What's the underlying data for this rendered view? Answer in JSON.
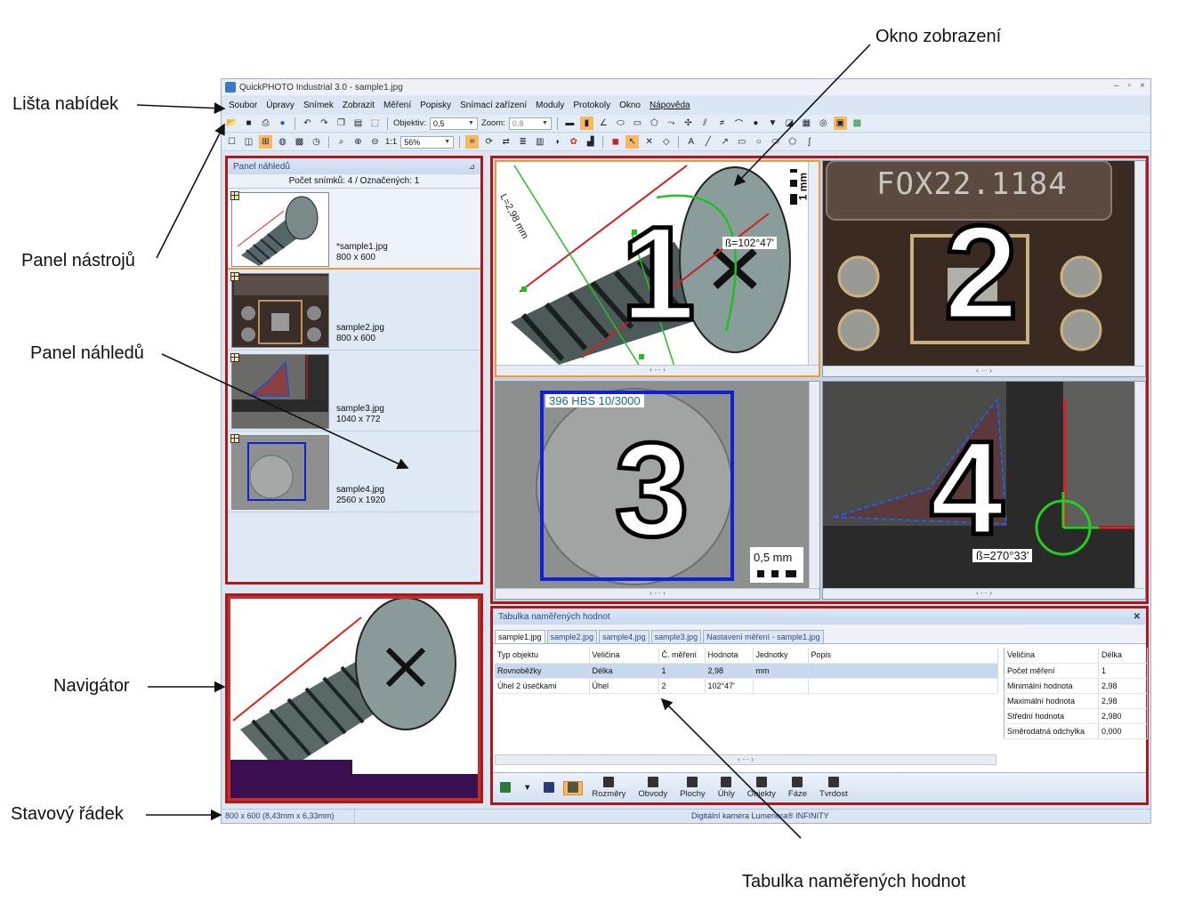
{
  "callouts": {
    "menu_bar": "Lišta nabídek",
    "toolbar": "Panel nástrojů",
    "thumbnail_panel": "Panel náhledů",
    "navigator": "Navigátor",
    "status_bar": "Stavový řádek",
    "display_window": "Okno zobrazení",
    "measurement_table": "Tabulka naměřených hodnot"
  },
  "window": {
    "title": "QuickPHOTO Industrial 3.0 - sample1.jpg",
    "controls": [
      "–",
      "▫",
      "×"
    ]
  },
  "menu": [
    "Soubor",
    "Úpravy",
    "Snímek",
    "Zobrazit",
    "Měření",
    "Popisky",
    "Snímací zařízení",
    "Moduly",
    "Protokoly",
    "Okno",
    "Nápověda"
  ],
  "toolbar": {
    "objective_label": "Objektiv:",
    "objective_value": "0,5",
    "zoom_label": "Zoom:",
    "zoom_value": "0,8",
    "scale_label": "1:1",
    "scale_value": "56%"
  },
  "thumbnail_panel": {
    "title": "Panel náhledů",
    "count_text": "Počet snímků: 4 / Označených: 1",
    "items": [
      {
        "name": "*sample1.jpg",
        "size": "800 x 600"
      },
      {
        "name": "sample2.jpg",
        "size": "800 x 600"
      },
      {
        "name": "sample3.jpg",
        "size": "1040 x 772"
      },
      {
        "name": "sample4.jpg",
        "size": "2560 x 1920"
      }
    ]
  },
  "views": {
    "v1": {
      "number": "1",
      "length_label": "L=2,98 mm",
      "angle_label": "ß=102°47'",
      "scale_label": "1 mm"
    },
    "v2": {
      "number": "2",
      "engraving": "FOX22.1184"
    },
    "v3": {
      "number": "3",
      "hardness_label": "396 HBS 10/3000",
      "scale_label": "0,5 mm"
    },
    "v4": {
      "number": "4",
      "angle_label": "ß=270°33'"
    }
  },
  "table_panel": {
    "title": "Tabulka naměřených hodnot",
    "tabs": [
      "sample1.jpg",
      "sample2.jpg",
      "sample4.jpg",
      "sample3.jpg",
      "Nastavení měření - sample1.jpg"
    ],
    "columns": [
      "Typ objektu",
      "Veličina",
      "Č. měření",
      "Hodnota",
      "Jednotky",
      "Popis"
    ],
    "rows": [
      [
        "Rovnoběžky",
        "Délka",
        "1",
        "2,98",
        "mm",
        ""
      ],
      [
        "Úhel 2 úsečkami",
        "Úhel",
        "2",
        "102°47'",
        "",
        ""
      ]
    ],
    "stats_columns": [
      "Veličina",
      "Délka"
    ],
    "stats": [
      [
        "Počet měření",
        "1"
      ],
      [
        "Minimální hodnota",
        "2,98"
      ],
      [
        "Maximální hodnota",
        "2,98"
      ],
      [
        "Střední hodnota",
        "2,980"
      ],
      [
        "Směrodatná odchylka",
        "0,000"
      ]
    ],
    "buttons": [
      "Rozměry",
      "Obvody",
      "Plochy",
      "Úhly",
      "Objekty",
      "Fáze",
      "Tvrdost"
    ]
  },
  "status": {
    "left": "800 x 600 (8,43mm x 6,33mm)",
    "camera": "Digitální kamera Lumenera® INFINITY"
  }
}
